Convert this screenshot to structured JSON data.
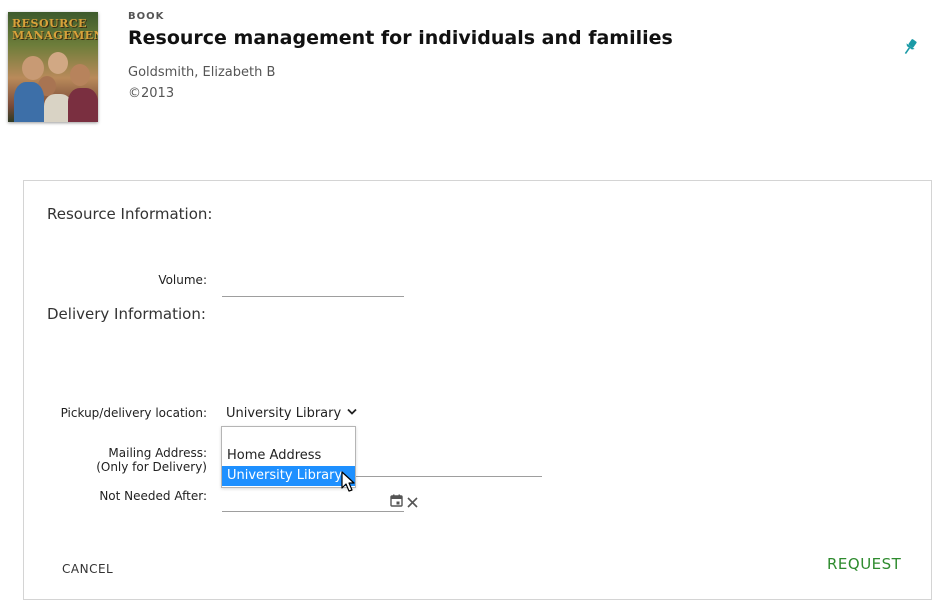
{
  "record": {
    "type": "BOOK",
    "title": "Resource management for individuals and families",
    "author": "Goldsmith, Elizabeth B",
    "date": "©2013",
    "cover_text": "RESOURCE MANAGEMENT"
  },
  "form": {
    "resource_section": "Resource Information:",
    "volume_label": "Volume:",
    "volume_value": "",
    "delivery_section": "Delivery Information:",
    "location_label": "Pickup/delivery location:",
    "location_value": "University Library",
    "location_options": [
      "Home Address",
      "University Library"
    ],
    "mailing_label_line1": "Mailing Address:",
    "mailing_label_line2": "(Only for Delivery)",
    "not_needed_label": "Not Needed After:",
    "not_needed_value": ""
  },
  "actions": {
    "cancel": "CANCEL",
    "request": "REQUEST"
  },
  "colors": {
    "accent_teal": "#1a9aa6",
    "request_green": "#2e8b2e",
    "selected_bg": "#1e90ff"
  },
  "icons": {
    "pin": "pin-icon",
    "calendar": "calendar-icon",
    "clear": "clear-icon",
    "chevron": "chevron-down-icon",
    "cursor": "mouse-cursor-icon"
  }
}
